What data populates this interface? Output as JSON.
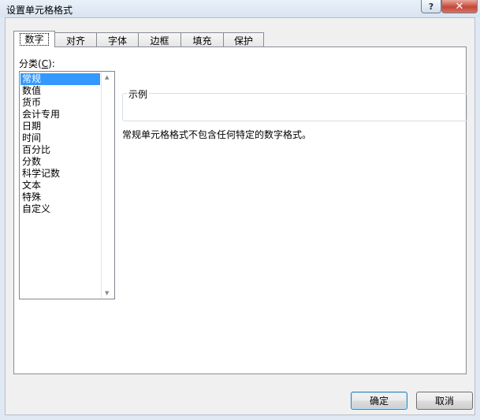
{
  "window": {
    "title": "设置单元格格式",
    "help_glyph": "?",
    "close_glyph": "✕"
  },
  "tabs": [
    {
      "label": "数字"
    },
    {
      "label": "对齐"
    },
    {
      "label": "字体"
    },
    {
      "label": "边框"
    },
    {
      "label": "填充"
    },
    {
      "label": "保护"
    }
  ],
  "category": {
    "label_prefix": "分类(",
    "label_mnemonic": "C",
    "label_suffix": "):",
    "items": [
      "常规",
      "数值",
      "货币",
      "会计专用",
      "日期",
      "时间",
      "百分比",
      "分数",
      "科学记数",
      "文本",
      "特殊",
      "自定义"
    ],
    "selected": "常规"
  },
  "sample": {
    "legend": "示例"
  },
  "description": "常规单元格格式不包含任何特定的数字格式。",
  "buttons": {
    "ok": "确定",
    "cancel": "取消"
  },
  "colors": {
    "selection": "#3399ff",
    "close_button": "#c4463a"
  }
}
